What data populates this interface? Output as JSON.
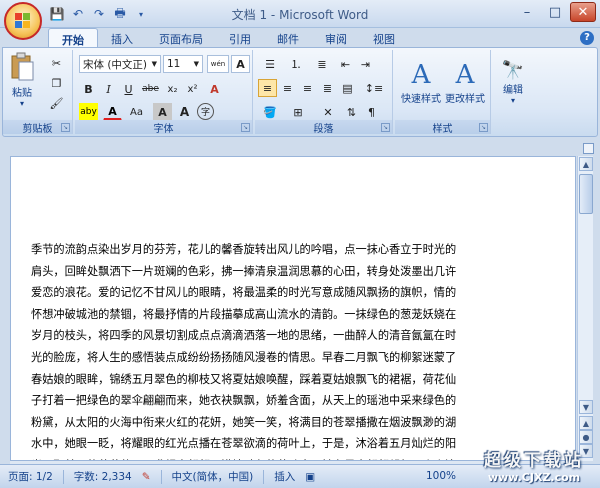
{
  "window": {
    "title": "文档 1 - Microsoft Word"
  },
  "qat": {
    "save": "💾",
    "undo": "↶",
    "redo": "↷",
    "preview": "🖶"
  },
  "tabs": [
    "开始",
    "插入",
    "页面布局",
    "引用",
    "邮件",
    "审阅",
    "视图"
  ],
  "help": "?",
  "ribbon": {
    "clipboard": {
      "label": "剪贴板",
      "paste": "粘贴"
    },
    "font": {
      "label": "字体",
      "name": "宋体 (中文正)",
      "size": "11",
      "bold": "B",
      "italic": "I",
      "underline": "U",
      "strike": "abe",
      "sub": "x₂",
      "sup": "x²",
      "clear": "A",
      "change_case": "Aa",
      "grow": "A",
      "phonetic": "wén",
      "char_border": "A",
      "highlight": "aby",
      "font_color": "A",
      "char_shading": "A",
      "enclose": "字"
    },
    "paragraph": {
      "label": "段落"
    },
    "styles": {
      "label": "样式",
      "quick": "快速样式",
      "change": "更改样式"
    },
    "editing": {
      "label": "编辑"
    }
  },
  "document": {
    "lines": [
      "季节的流韵点染出岁月的芬芳，花儿的馨香旋转出风儿的吟唱，点一抹心香立于时光的",
      "肩头，回眸处飘洒下一片斑斓的色彩，拂一捧清泉温润思慕的心田，转身处泼墨出几许",
      "爱恋的浪花。爱的记忆不甘风儿的眼睛，将最温柔的时光写意成随风飘扬的旗帜，情的",
      "怀想冲破城池的禁锢，将最抒情的片段描摹成高山流水的清韵。一抹绿色的葱茏妖娆在",
      "岁月的枝头，将四季的风景切割成点点滴滴洒落一地的思绪，一曲醉人的清音氤氲在时",
      "光的脸庞，将人生的感悟装点成纷纷扬扬随风漫卷的情思。早春二月飘飞的柳絮迷蒙了",
      "春姑娘的眼眸，锦绣五月翠色的柳枝又将夏姑娘唤醒，踩着夏姑娘飘飞的裙裾，荷花仙",
      "子打着一把绿色的翠伞翩翩而来，她衣袂飘飘，娇羞含面，从天上的瑶池中采来绿色的",
      "粉黛，从太阳的火海中衔来火红的花妍，她笑一笑，将满目的苍翠播撒在烟波飘渺的湖",
      "水中，她眼一眨，将耀眼的红光点播在苍翠欲滴的荷叶上，于是，沐浴着五月灿烂的阳",
      "光，那美丽的荷花仙子一袭绿衣翩翩于满塘碧色的荷叶中，她在风中翩翩起舞，点点滴"
    ]
  },
  "status": {
    "page": "页面: 1/2",
    "words": "字数: 2,334",
    "lang": "中文(简体，中国)",
    "mode": "插入",
    "zoom": "100%"
  },
  "watermark": {
    "line1": "超级下载站",
    "line2": "www.CJXZ.com"
  }
}
